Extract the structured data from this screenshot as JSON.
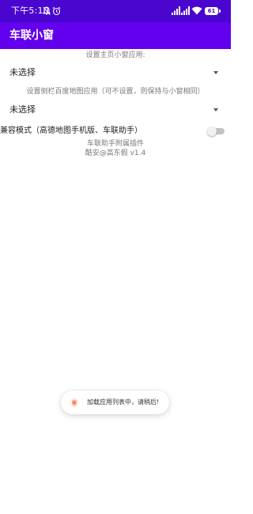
{
  "status_bar": {
    "time": "下午5:10",
    "battery_level": "61",
    "background_color": "#4a06cf",
    "icons": [
      "mute-icon",
      "alarm-icon",
      "signal-icon",
      "signal-icon",
      "wifi-icon",
      "battery-icon"
    ]
  },
  "app_bar": {
    "title": "车联小窗",
    "background_color": "#6200ee"
  },
  "main": {
    "home_window_caption": "设置主页小窗应用:",
    "home_window_select": {
      "value": "未选择",
      "icon": "dropdown-arrow-icon"
    },
    "sidebar_map_caption": "设置侧栏百度地图应用（可不设置，则保持与小窗相同）",
    "sidebar_map_select": {
      "value": "未选择",
      "icon": "dropdown-arrow-icon"
    },
    "compat_mode": {
      "label": "兼容模式（高德地图手机版、车联助手）",
      "enabled": false
    },
    "footer_line1": "车联助手附属插件",
    "footer_line2": "酷安@高东假 v1.4"
  },
  "toast": {
    "message": "加载应用列表中，请稍后!",
    "icon": "app-icon"
  }
}
